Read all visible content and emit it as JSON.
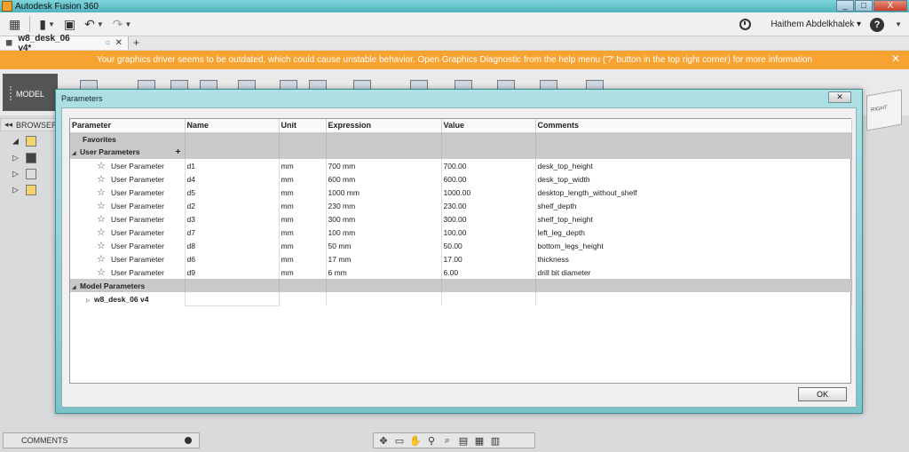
{
  "window": {
    "title": "Autodesk Fusion 360",
    "controls": [
      "_",
      "□",
      "X"
    ]
  },
  "toolbar": {
    "user": "Haithem Abdelkhalek ▾",
    "help": "?"
  },
  "tab": {
    "label": "w8_desk_06 v4*",
    "status": "○",
    "close": "✕",
    "new": "+"
  },
  "banner": {
    "message": "Your graphics driver seems to be outdated, which could cause unstable behavior. Open Graphics Diagnostic from the help menu ('?' button in the top right corner) for more information",
    "close": "✕"
  },
  "workspace": {
    "model_label": "MODEL",
    "browser_label": "BROWSER"
  },
  "viewcube": {
    "face": "RIGHT"
  },
  "comments": {
    "label": "COMMENTS"
  },
  "dialog": {
    "title": "Parameters",
    "close": "✕",
    "columns": [
      "Parameter",
      "Name",
      "Unit",
      "Expression",
      "Value",
      "Comments"
    ],
    "favorites": "Favorites",
    "user_group": "User Parameters",
    "add": "+",
    "user_params": [
      {
        "type": "User Parameter",
        "name": "d1",
        "unit": "mm",
        "expression": "700 mm",
        "value": "700.00",
        "comment": "desk_top_height"
      },
      {
        "type": "User Parameter",
        "name": "d4",
        "unit": "mm",
        "expression": "600 mm",
        "value": "600.00",
        "comment": "desk_top_width"
      },
      {
        "type": "User Parameter",
        "name": "d5",
        "unit": "mm",
        "expression": "1000 mm",
        "value": "1000.00",
        "comment": "desktop_length_without_shelf"
      },
      {
        "type": "User Parameter",
        "name": "d2",
        "unit": "mm",
        "expression": "230 mm",
        "value": "230.00",
        "comment": "shelf_depth"
      },
      {
        "type": "User Parameter",
        "name": "d3",
        "unit": "mm",
        "expression": "300 mm",
        "value": "300.00",
        "comment": "shelf_top_height"
      },
      {
        "type": "User Parameter",
        "name": "d7",
        "unit": "mm",
        "expression": "100 mm",
        "value": "100.00",
        "comment": "left_leg_depth"
      },
      {
        "type": "User Parameter",
        "name": "d8",
        "unit": "mm",
        "expression": "50 mm",
        "value": "50.00",
        "comment": "bottom_legs_height"
      },
      {
        "type": "User Parameter",
        "name": "d6",
        "unit": "mm",
        "expression": "17 mm",
        "value": "17.00",
        "comment": "thickness"
      },
      {
        "type": "User Parameter",
        "name": "d9",
        "unit": "mm",
        "expression": "6 mm",
        "value": "6.00",
        "comment": "drill bit diameter"
      }
    ],
    "model_group": "Model Parameters",
    "model_component": "w8_desk_06 v4",
    "ok": "OK"
  }
}
